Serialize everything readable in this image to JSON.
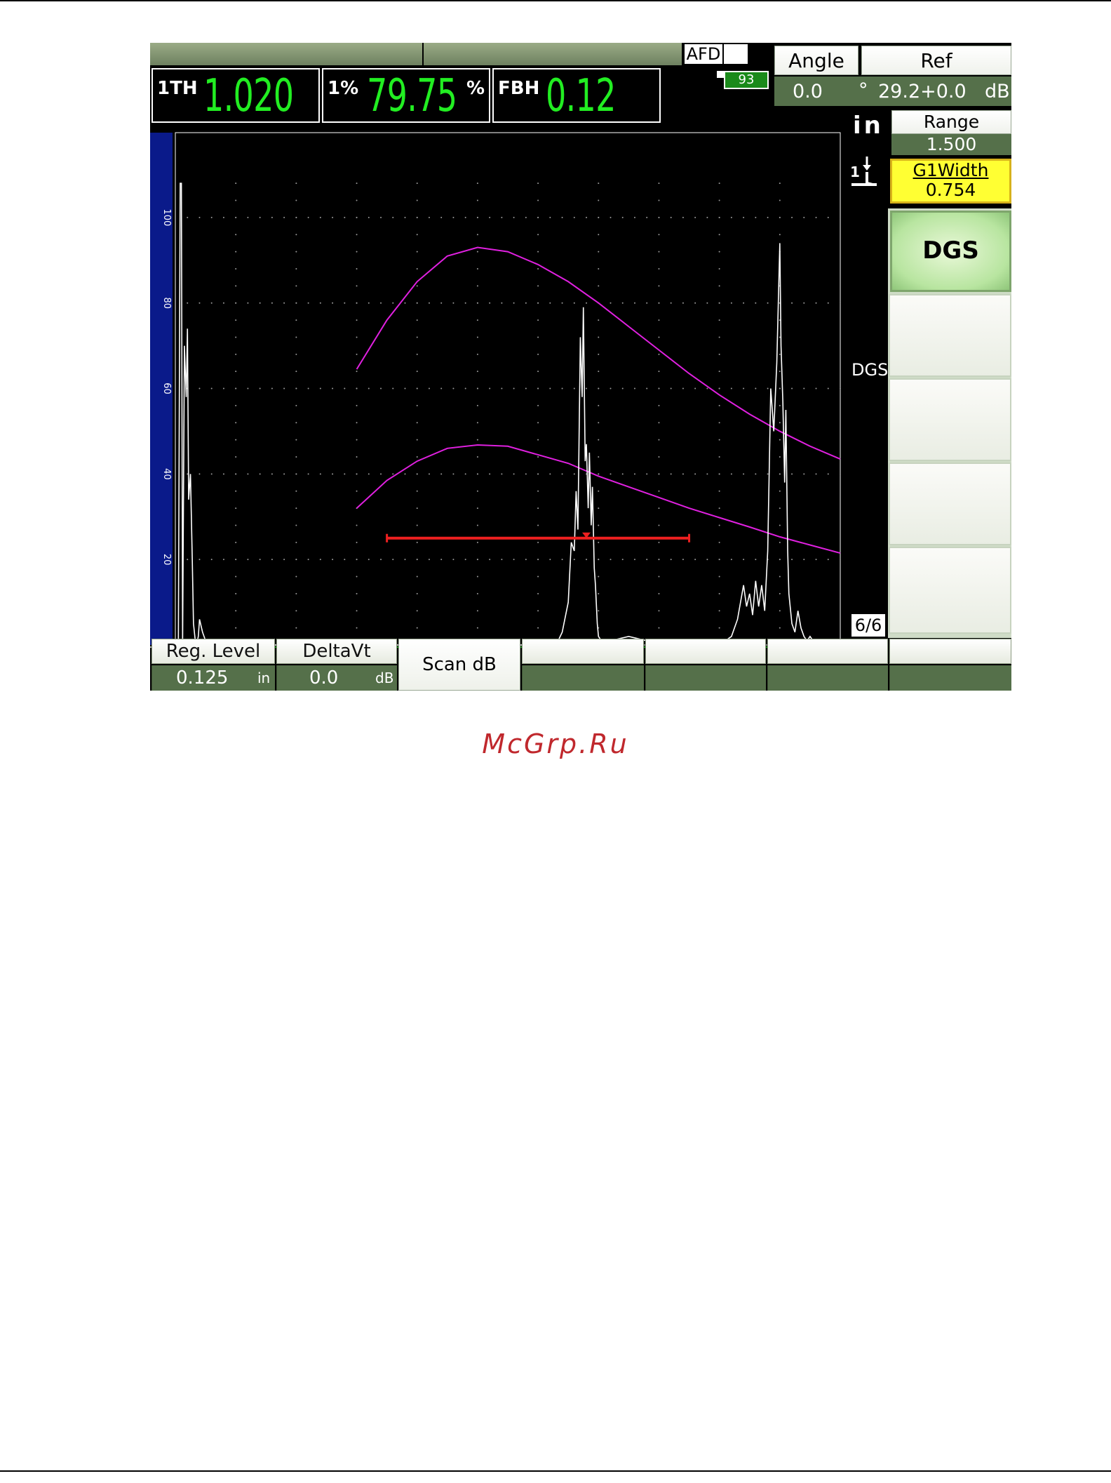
{
  "header": {
    "afd_label": "AFD",
    "battery_level": "93"
  },
  "measurements": [
    {
      "label": "1TH",
      "value": "1.020",
      "unit": ""
    },
    {
      "label": "1%",
      "value": "79.75",
      "unit": "%"
    },
    {
      "label": "FBH",
      "value": "0.12",
      "unit": ""
    }
  ],
  "params": {
    "angle_label": "Angle",
    "angle_value": "0.0",
    "angle_unit": "°",
    "ref_label": "Ref",
    "ref_value": "29.2+0.0",
    "ref_unit": "dB",
    "units_label": "in",
    "gate_icon_label": "1",
    "range_label": "Range",
    "range_value": "1.500",
    "g1width_label": "G1Width",
    "g1width_value": "0.754"
  },
  "side_menu": {
    "active_label": "DGS",
    "mode_label": "DGS",
    "page_indicator": "6/6"
  },
  "function_keys": [
    {
      "label": "Reg. Level",
      "value": "0.125",
      "unit": "in"
    },
    {
      "label": "DeltaVt",
      "value": "0.0",
      "unit": "dB"
    },
    {
      "label": "Scan dB"
    }
  ],
  "chart_data": {
    "type": "line",
    "xlim": [
      0,
      11
    ],
    "ylim": [
      0,
      110
    ],
    "x_ticks": [
      "0",
      "1",
      "2",
      "3",
      "4",
      "5",
      "6",
      "7",
      "8",
      "9",
      "10"
    ],
    "y_ticks": [
      "0",
      "20",
      "40",
      "60",
      "80",
      "100"
    ],
    "grid": true,
    "colors": {
      "curves": "#e020e0",
      "signal": "#ffffff",
      "gate": "#ee2020"
    },
    "dgs_curves": [
      {
        "x": [
          3,
          3.5,
          4,
          4.5,
          5,
          5.5,
          6,
          6.5,
          7,
          7.5,
          8,
          8.5,
          9,
          9.5,
          10,
          10.5,
          11
        ],
        "y": [
          64.5,
          76,
          85,
          91,
          93,
          92,
          89,
          85,
          80,
          74.5,
          69,
          63.5,
          58.5,
          54,
          50,
          46.5,
          43.5
        ]
      },
      {
        "x": [
          3,
          3.5,
          4,
          4.5,
          5,
          5.5,
          6,
          6.5,
          7,
          7.5,
          8,
          8.5,
          9,
          9.5,
          10,
          10.5,
          11
        ],
        "y": [
          32,
          38.5,
          43,
          46,
          46.8,
          46.5,
          44.5,
          42.5,
          39.5,
          37,
          34.5,
          32,
          29.8,
          27.6,
          25.3,
          23.4,
          21.5
        ]
      }
    ],
    "gate": {
      "start": 3.5,
      "end": 8.5,
      "level": 25,
      "marker": 6.8
    },
    "ascan": {
      "x": [
        0.05,
        0.08,
        0.1,
        0.12,
        0.15,
        0.18,
        0.2,
        0.22,
        0.25,
        0.28,
        0.3,
        0.33,
        0.35,
        0.38,
        0.4,
        0.45,
        0.5,
        0.55,
        0.6,
        0.65,
        0.7,
        0.8,
        1.0,
        1.2,
        1.3,
        1.5,
        2.0,
        2.5,
        3.0,
        3.5,
        4.0,
        4.2,
        4.25,
        4.3,
        4.5,
        5.0,
        5.5,
        6.0,
        6.3,
        6.4,
        6.5,
        6.55,
        6.6,
        6.63,
        6.66,
        6.7,
        6.73,
        6.75,
        6.78,
        6.8,
        6.83,
        6.85,
        6.88,
        6.9,
        6.93,
        6.95,
        6.98,
        7.0,
        7.05,
        7.1,
        7.2,
        7.5,
        7.8,
        8.0,
        8.5,
        9.0,
        9.2,
        9.3,
        9.35,
        9.4,
        9.45,
        9.5,
        9.55,
        9.6,
        9.65,
        9.7,
        9.75,
        9.8,
        9.85,
        9.9,
        9.95,
        10.0,
        10.02,
        10.05,
        10.08,
        10.1,
        10.13,
        10.15,
        10.2,
        10.25,
        10.3,
        10.35,
        10.4,
        10.45,
        10.5,
        10.55,
        10.6,
        10.7,
        10.8,
        11.0
      ],
      "y": [
        0,
        108,
        108,
        0,
        70,
        58,
        74,
        34,
        40,
        20,
        5,
        1,
        0,
        2,
        6,
        3,
        1,
        0,
        0,
        1,
        0,
        0,
        0,
        1,
        0,
        0,
        0,
        0,
        0,
        0,
        0,
        1,
        0,
        0,
        0,
        0,
        0,
        0,
        0,
        3,
        10,
        24,
        22,
        36,
        27,
        72,
        58,
        79,
        43,
        47,
        32,
        45,
        28,
        37,
        18,
        14,
        5,
        2,
        1,
        0,
        1,
        2,
        1,
        0,
        0,
        0,
        2,
        6,
        10,
        14,
        9,
        12,
        7,
        15,
        9,
        14,
        8,
        22,
        60,
        50,
        66,
        94,
        70,
        57,
        38,
        55,
        22,
        12,
        5,
        3,
        8,
        4,
        2,
        1,
        2,
        1,
        0,
        1,
        0,
        1
      ]
    }
  }
}
